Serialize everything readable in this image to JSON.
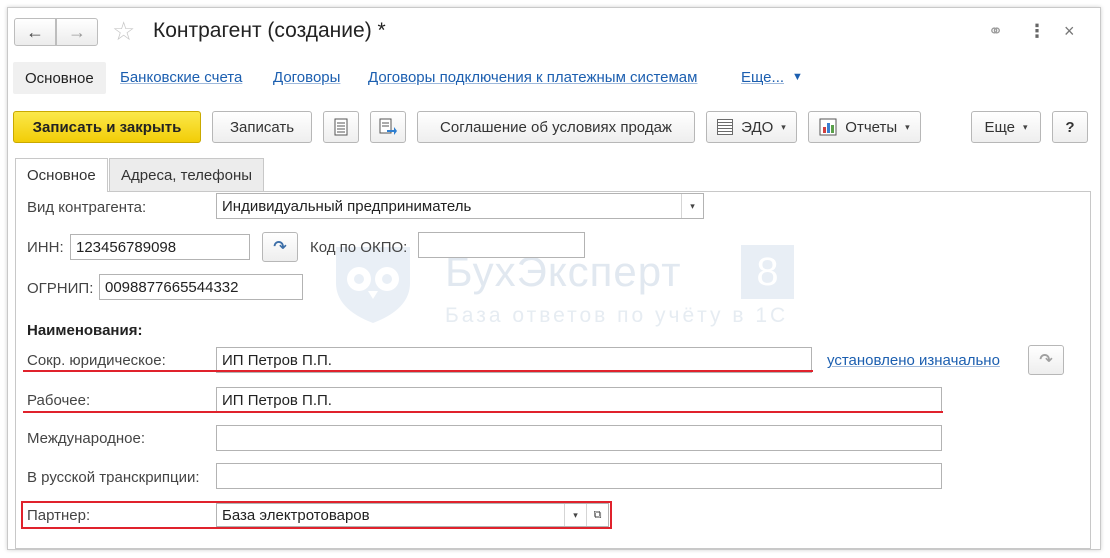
{
  "window": {
    "title": "Контрагент (создание) *",
    "nav_back": "←",
    "nav_forward": "→",
    "star": "☆",
    "link_icon": "⚭",
    "menu_icon": "⋮",
    "close_icon": "×"
  },
  "nav": {
    "active": "Основное",
    "links": [
      "Банковские счета",
      "Договоры",
      "Договоры подключения к платежным системам",
      "Еще..."
    ],
    "more_arrow": "▼"
  },
  "toolbar": {
    "save_close": "Записать и закрыть",
    "save": "Записать",
    "agreement": "Соглашение об условиях продаж",
    "edo": "ЭДО",
    "reports": "Отчеты",
    "more": "Еще",
    "help": "?",
    "dropdown": "▾"
  },
  "tabs": [
    "Основное",
    "Адреса, телефоны"
  ],
  "form": {
    "kind_label": "Вид контрагента:",
    "kind_value": "Индивидуальный предприниматель",
    "inn_label": "ИНН:",
    "inn_value": "123456789098",
    "okpo_label": "Код по ОКПО:",
    "okpo_value": "",
    "ogrnip_label": "ОГРНИП:",
    "ogrnip_value": "0098877665544332",
    "names_header": "Наименования:",
    "short_label": "Сокр. юридическое:",
    "short_value": "ИП Петров П.П.",
    "short_link": "установлено изначально",
    "work_label": "Рабочее:",
    "work_value": "ИП Петров П.П.",
    "intl_label": "Международное:",
    "intl_value": "",
    "ru_label": "В русской транскрипции:",
    "ru_value": "",
    "partner_label": "Партнер:",
    "partner_value": "База электротоваров",
    "arrow_glyph": "↷",
    "open_glyph": "⧉"
  },
  "watermark": {
    "title": "БухЭксперт",
    "number": "8",
    "subtitle": "База ответов по учёту в 1С"
  },
  "colors": {
    "accent_yellow": "#f5d20c",
    "link_blue": "#1c5fb0",
    "highlight_red": "#e0222c"
  }
}
